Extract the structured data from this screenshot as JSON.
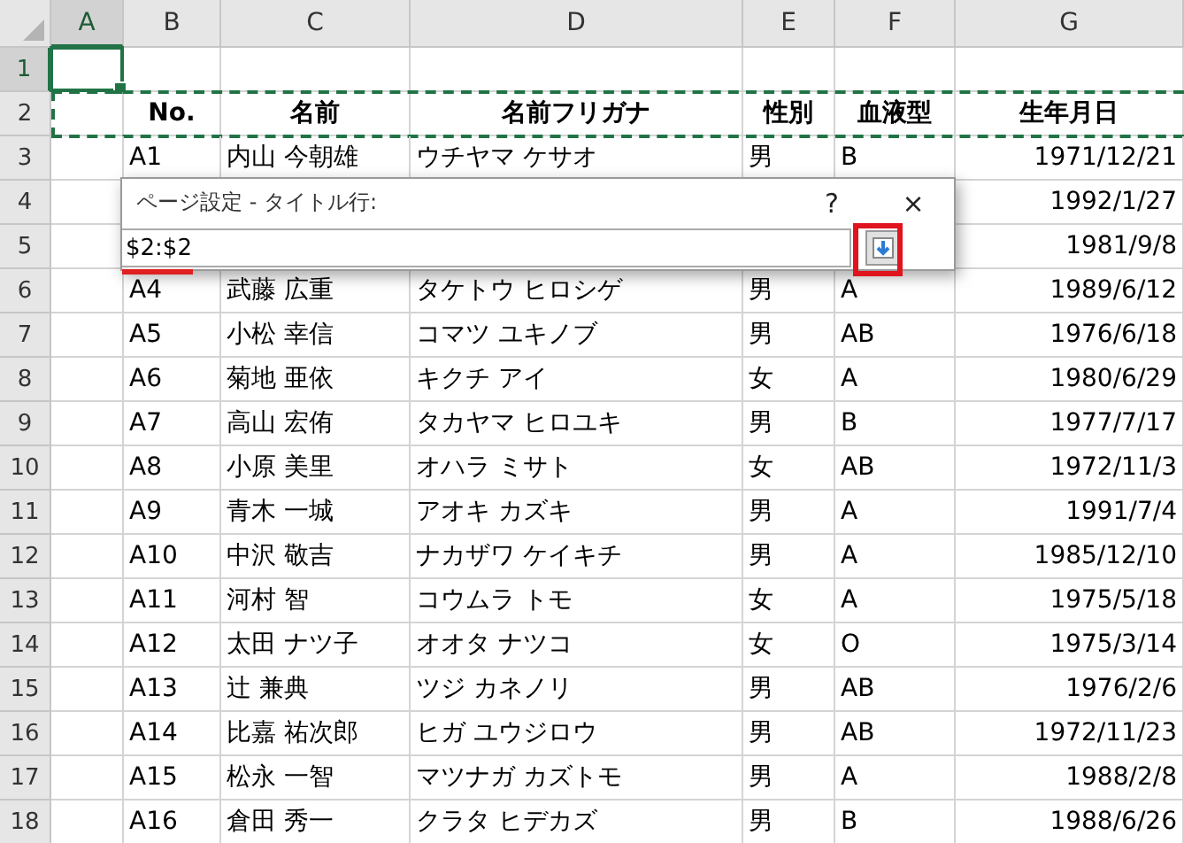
{
  "columns": [
    {
      "label": "A",
      "selected": true
    },
    {
      "label": "B",
      "selected": false
    },
    {
      "label": "C",
      "selected": false
    },
    {
      "label": "D",
      "selected": false
    },
    {
      "label": "E",
      "selected": false
    },
    {
      "label": "F",
      "selected": false
    },
    {
      "label": "G",
      "selected": false
    }
  ],
  "rows": [
    {
      "number": "1",
      "selected": true,
      "marquee": false,
      "kind": "blank"
    },
    {
      "number": "2",
      "selected": false,
      "marquee": true,
      "kind": "header",
      "no": "No.",
      "name": "名前",
      "kana": "名前フリガナ",
      "sex": "性別",
      "blood": "血液型",
      "birth": "生年月日"
    },
    {
      "number": "3",
      "selected": false,
      "marquee": false,
      "kind": "data",
      "no": "A1",
      "name": "内山 今朝雄",
      "kana": "ウチヤマ ケサオ",
      "sex": "男",
      "blood": "B",
      "birth": "1971/12/21"
    },
    {
      "number": "4",
      "selected": false,
      "marquee": false,
      "kind": "data",
      "birth": "1992/1/27"
    },
    {
      "number": "5",
      "selected": false,
      "marquee": false,
      "kind": "data",
      "birth": "1981/9/8"
    },
    {
      "number": "6",
      "selected": false,
      "marquee": false,
      "kind": "data",
      "no": "A4",
      "name": "武藤 広重",
      "kana": "タケトウ ヒロシゲ",
      "sex": "男",
      "blood": "A",
      "birth": "1989/6/12"
    },
    {
      "number": "7",
      "selected": false,
      "marquee": false,
      "kind": "data",
      "no": "A5",
      "name": "小松 幸信",
      "kana": "コマツ ユキノブ",
      "sex": "男",
      "blood": "AB",
      "birth": "1976/6/18"
    },
    {
      "number": "8",
      "selected": false,
      "marquee": false,
      "kind": "data",
      "no": "A6",
      "name": "菊地 亜依",
      "kana": "キクチ アイ",
      "sex": "女",
      "blood": "A",
      "birth": "1980/6/29"
    },
    {
      "number": "9",
      "selected": false,
      "marquee": false,
      "kind": "data",
      "no": "A7",
      "name": "高山 宏侑",
      "kana": "タカヤマ ヒロユキ",
      "sex": "男",
      "blood": "B",
      "birth": "1977/7/17"
    },
    {
      "number": "10",
      "selected": false,
      "marquee": false,
      "kind": "data",
      "no": "A8",
      "name": "小原 美里",
      "kana": "オハラ ミサト",
      "sex": "女",
      "blood": "AB",
      "birth": "1972/11/3"
    },
    {
      "number": "11",
      "selected": false,
      "marquee": false,
      "kind": "data",
      "no": "A9",
      "name": "青木 一城",
      "kana": "アオキ カズキ",
      "sex": "男",
      "blood": "A",
      "birth": "1991/7/4"
    },
    {
      "number": "12",
      "selected": false,
      "marquee": false,
      "kind": "data",
      "no": "A10",
      "name": "中沢 敬吉",
      "kana": "ナカザワ ケイキチ",
      "sex": "男",
      "blood": "A",
      "birth": "1985/12/10"
    },
    {
      "number": "13",
      "selected": false,
      "marquee": false,
      "kind": "data",
      "no": "A11",
      "name": "河村 智",
      "kana": "コウムラ トモ",
      "sex": "女",
      "blood": "A",
      "birth": "1975/5/18"
    },
    {
      "number": "14",
      "selected": false,
      "marquee": false,
      "kind": "data",
      "no": "A12",
      "name": "太田 ナツ子",
      "kana": "オオタ ナツコ",
      "sex": "女",
      "blood": "O",
      "birth": "1975/3/14"
    },
    {
      "number": "15",
      "selected": false,
      "marquee": false,
      "kind": "data",
      "no": "A13",
      "name": "辻 兼典",
      "kana": "ツジ カネノリ",
      "sex": "男",
      "blood": "AB",
      "birth": "1976/2/6"
    },
    {
      "number": "16",
      "selected": false,
      "marquee": false,
      "kind": "data",
      "no": "A14",
      "name": "比嘉 祐次郎",
      "kana": "ヒガ ユウジロウ",
      "sex": "男",
      "blood": "AB",
      "birth": "1972/11/23"
    },
    {
      "number": "17",
      "selected": false,
      "marquee": false,
      "kind": "data",
      "no": "A15",
      "name": "松永 一智",
      "kana": "マツナガ カズトモ",
      "sex": "男",
      "blood": "A",
      "birth": "1988/2/8"
    },
    {
      "number": "18",
      "selected": false,
      "marquee": false,
      "kind": "data",
      "no": "A16",
      "name": "倉田 秀一",
      "kana": "クラタ ヒデカズ",
      "sex": "男",
      "blood": "B",
      "birth": "1988/6/26"
    }
  ],
  "dialog": {
    "title": "ページ設定 - タイトル行:",
    "help": "?",
    "close": "×",
    "value": "$2:$2",
    "underline": true,
    "button_highlighted": true
  }
}
